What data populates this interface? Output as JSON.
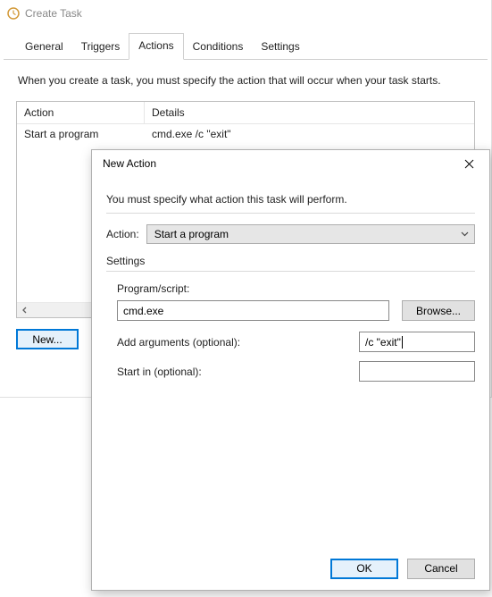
{
  "parent": {
    "title": "Create Task",
    "tabs": [
      "General",
      "Triggers",
      "Actions",
      "Conditions",
      "Settings"
    ],
    "active_tab": "Actions",
    "intro": "When you create a task, you must specify the action that will occur when your task starts.",
    "table": {
      "headers": [
        "Action",
        "Details"
      ],
      "rows": [
        {
          "action": "Start a program",
          "details": "cmd.exe /c \"exit\""
        }
      ]
    },
    "new_button": "New..."
  },
  "modal": {
    "title": "New Action",
    "intro": "You must specify what action this task will perform.",
    "action_label": "Action:",
    "action_value": "Start a program",
    "settings_title": "Settings",
    "program_label": "Program/script:",
    "program_value": "cmd.exe",
    "browse_button": "Browse...",
    "args_label": "Add arguments (optional):",
    "args_value": "/c \"exit\"",
    "startin_label": "Start in (optional):",
    "startin_value": "",
    "ok_button": "OK",
    "cancel_button": "Cancel"
  }
}
